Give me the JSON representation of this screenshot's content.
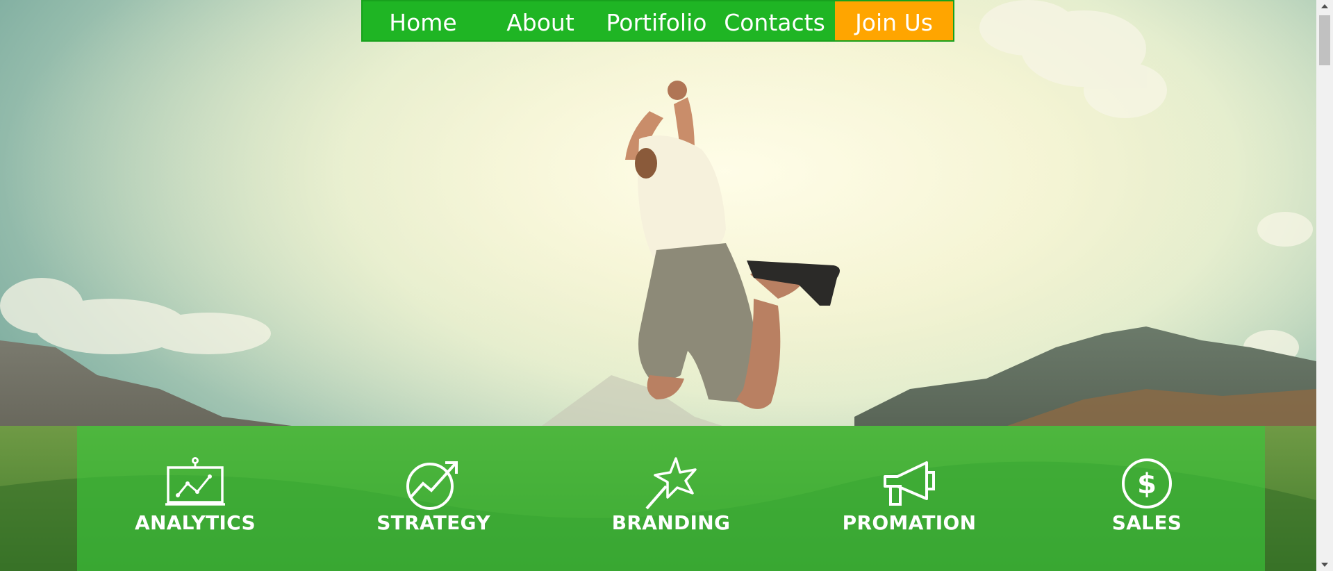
{
  "nav": {
    "items": [
      {
        "label": "Home"
      },
      {
        "label": "About"
      },
      {
        "label": "Portifolio"
      },
      {
        "label": "Contacts"
      }
    ],
    "cta_label": "Join Us",
    "colors": {
      "bar": "#1fb524",
      "cta": "#ffa500",
      "text": "#ffffff"
    }
  },
  "services": {
    "band_color": "#3ac83a",
    "items": [
      {
        "label": "ANALYTICS",
        "icon": "presentation-chart-icon"
      },
      {
        "label": "STRATEGY",
        "icon": "growth-arrow-icon"
      },
      {
        "label": "BRANDING",
        "icon": "star-wand-icon"
      },
      {
        "label": "PROMATION",
        "icon": "megaphone-icon"
      },
      {
        "label": "SALES",
        "icon": "dollar-coin-icon"
      }
    ]
  }
}
